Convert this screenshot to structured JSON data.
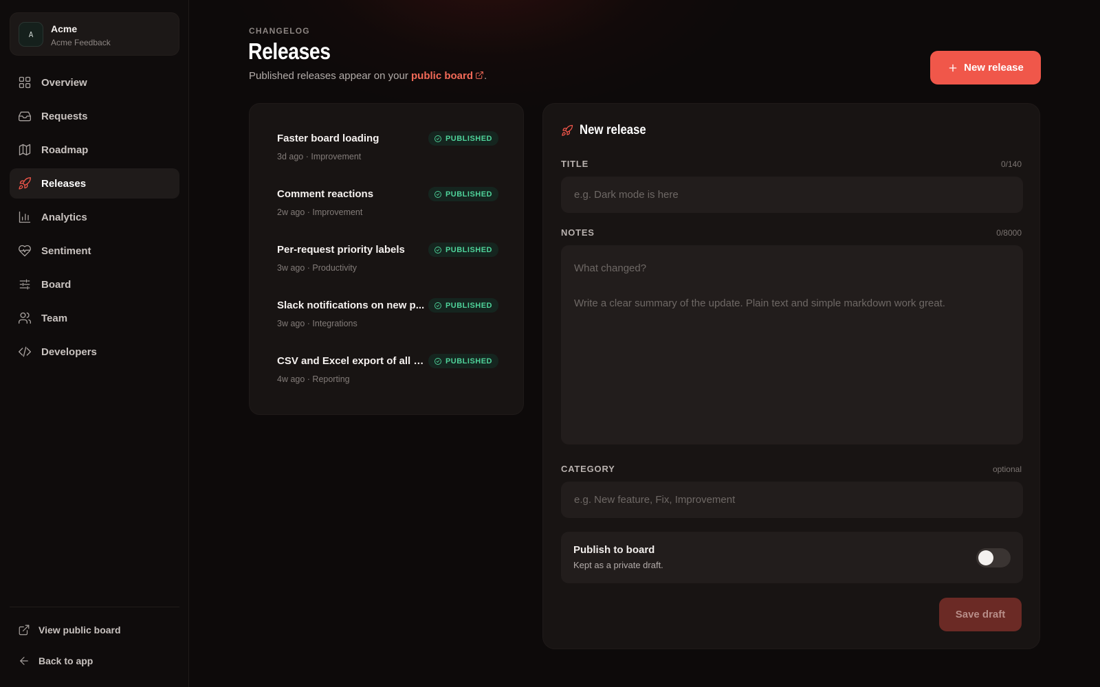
{
  "workspace": {
    "initial": "A",
    "name": "Acme",
    "subtitle": "Acme Feedback"
  },
  "nav": [
    {
      "label": "Overview",
      "icon": "grid-icon",
      "active": false
    },
    {
      "label": "Requests",
      "icon": "inbox-icon",
      "active": false
    },
    {
      "label": "Roadmap",
      "icon": "map-icon",
      "active": false
    },
    {
      "label": "Releases",
      "icon": "rocket-icon",
      "active": true
    },
    {
      "label": "Analytics",
      "icon": "bar-chart-icon",
      "active": false
    },
    {
      "label": "Sentiment",
      "icon": "heart-pulse-icon",
      "active": false
    },
    {
      "label": "Board",
      "icon": "sliders-icon",
      "active": false
    },
    {
      "label": "Team",
      "icon": "users-icon",
      "active": false
    },
    {
      "label": "Developers",
      "icon": "code-icon",
      "active": false
    }
  ],
  "footer": {
    "view_board": "View public board",
    "back": "Back to app"
  },
  "header": {
    "eyebrow": "CHANGELOG",
    "title": "Releases",
    "subtitle_pre": "Published releases appear on your",
    "subtitle_link": "public board",
    "subtitle_post": ".",
    "new_button": "New release"
  },
  "releases": [
    {
      "title": "Faster board loading",
      "meta": "3d ago · Improvement",
      "status": "PUBLISHED"
    },
    {
      "title": "Comment reactions",
      "meta": "2w ago · Improvement",
      "status": "PUBLISHED"
    },
    {
      "title": "Per-request priority labels",
      "meta": "3w ago · Productivity",
      "status": "PUBLISHED"
    },
    {
      "title": "Slack notifications on new p...",
      "meta": "3w ago · Integrations",
      "status": "PUBLISHED"
    },
    {
      "title": "CSV and Excel export of all r...",
      "meta": "4w ago · Reporting",
      "status": "PUBLISHED"
    }
  ],
  "form": {
    "heading": "New release",
    "title_label": "TITLE",
    "title_count": "0/140",
    "title_placeholder": "e.g. Dark mode is here",
    "title_value": "",
    "notes_label": "NOTES",
    "notes_count": "0/8000",
    "notes_placeholder": "What changed?\n\nWrite a clear summary of the update. Plain text and simple markdown work great.",
    "notes_value": "",
    "category_label": "CATEGORY",
    "category_hint": "optional",
    "category_placeholder": "e.g. New feature, Fix, Improvement",
    "category_value": "",
    "publish_title": "Publish to board",
    "publish_sub": "Kept as a private draft.",
    "publish_on": false,
    "save_button": "Save draft"
  },
  "colors": {
    "accent": "#f0574a",
    "success": "#4fd39a",
    "background": "#0d0a0a",
    "card": "#181413"
  }
}
